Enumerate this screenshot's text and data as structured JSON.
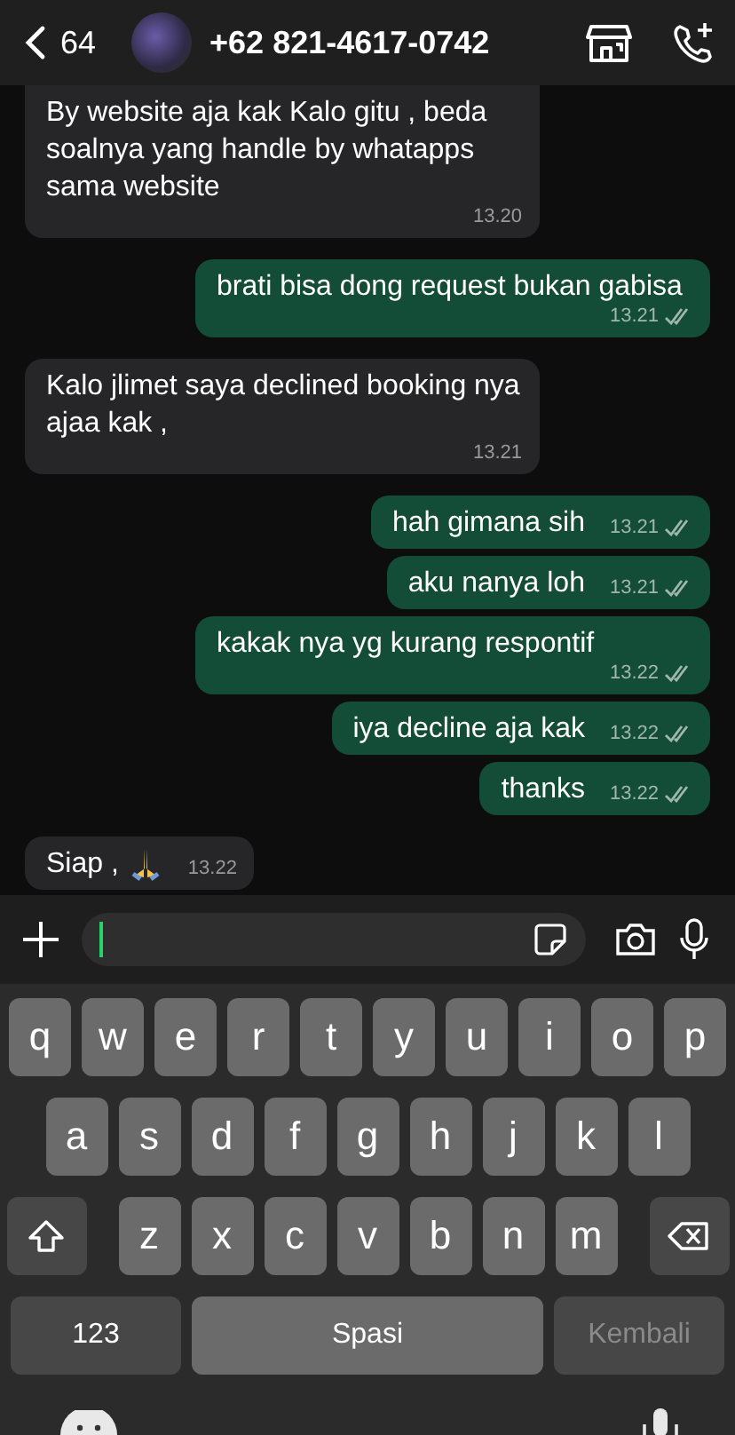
{
  "header": {
    "back_count": "64",
    "contact": "+62 821-4617-0742"
  },
  "messages": [
    {
      "kind": "incoming",
      "text": "By website aja kak Kalo gitu , beda soalnya yang handle by whatapps sama website",
      "time": "13.20"
    },
    {
      "kind": "outgoing",
      "text": "brati bisa dong request bukan gabisa",
      "time": "13.21"
    },
    {
      "kind": "incoming",
      "text": "Kalo jlimet saya declined booking nya ajaa kak ,",
      "time": "13.21"
    },
    {
      "kind": "outgoing",
      "text": "hah gimana sih",
      "time": "13.21"
    },
    {
      "kind": "outgoing",
      "text": "aku nanya loh",
      "time": "13.21"
    },
    {
      "kind": "outgoing",
      "text": "kakak nya yg kurang respontif",
      "time": "13.22"
    },
    {
      "kind": "outgoing",
      "text": "iya decline aja kak",
      "time": "13.22"
    },
    {
      "kind": "outgoing",
      "text": "thanks",
      "time": "13.22"
    },
    {
      "kind": "incoming",
      "text": "Siap ,",
      "praying_hands": true,
      "time": "13.22"
    }
  ],
  "keyboard": {
    "letter_rows": [
      [
        "q",
        "w",
        "e",
        "r",
        "t",
        "y",
        "u",
        "i",
        "o",
        "p"
      ],
      [
        "a",
        "s",
        "d",
        "f",
        "g",
        "h",
        "j",
        "k",
        "l"
      ],
      [
        "z",
        "x",
        "c",
        "v",
        "b",
        "n",
        "m"
      ]
    ],
    "numbers_key": "123",
    "space_key": "Spasi",
    "return_key": {
      "label": "Kembali",
      "disabled": true
    }
  }
}
